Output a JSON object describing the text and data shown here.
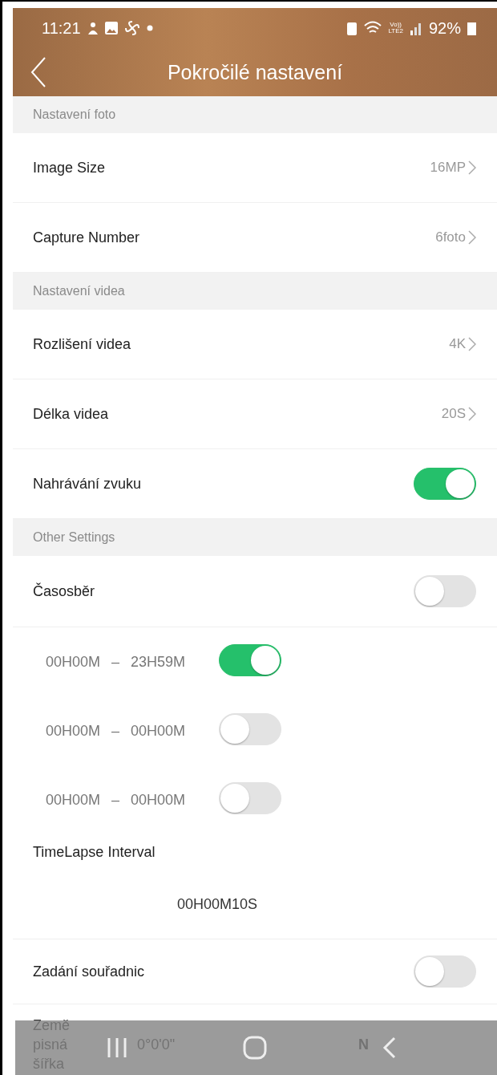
{
  "status_bar": {
    "time": "11:21",
    "network": "Vo))\nLTE2",
    "battery": "92%"
  },
  "header": {
    "title": "Pokročilé nastavení"
  },
  "sections": [
    {
      "title": "Nastavení foto",
      "items": [
        {
          "kind": "value",
          "label": "Image Size",
          "value": "16MP"
        },
        {
          "kind": "value",
          "label": "Capture Number",
          "value": "6foto"
        }
      ]
    },
    {
      "title": "Nastavení videa",
      "items": [
        {
          "kind": "value",
          "label": "Rozlišení videa",
          "value": "4K"
        },
        {
          "kind": "value",
          "label": "Délka videa",
          "value": "20S"
        },
        {
          "kind": "toggle",
          "label": "Nahrávání zvuku",
          "on": true
        }
      ]
    },
    {
      "title": "Other Settings",
      "items": [
        {
          "kind": "toggle",
          "label": "Časosběr",
          "on": false
        }
      ]
    }
  ],
  "time_ranges": [
    {
      "start": "00H00M",
      "dash": "–",
      "end": "23H59M",
      "on": true
    },
    {
      "start": "00H00M",
      "dash": "–",
      "end": "00H00M",
      "on": false
    },
    {
      "start": "00H00M",
      "dash": "–",
      "end": "00H00M",
      "on": false
    }
  ],
  "interval": {
    "label": "TimeLapse Interval",
    "value": "00H00M10S"
  },
  "coordinates": {
    "label": "Zadání souřadnic",
    "on": false,
    "latitude": {
      "label_lines": [
        "Země",
        "pisná",
        "šířka"
      ],
      "value": "0°0'0\"",
      "hemisphere": "N"
    }
  }
}
